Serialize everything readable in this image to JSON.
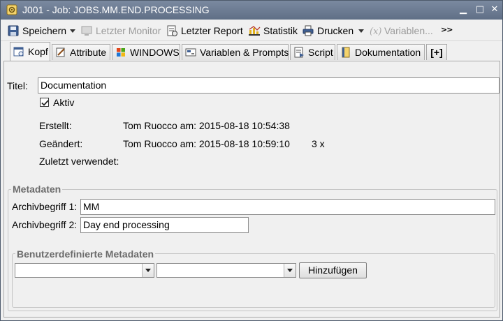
{
  "window": {
    "title": "J001 - Job: JOBS.MM.END.PROCESSING",
    "minimize_glyph": "▁",
    "maximize_glyph": "□",
    "close_glyph": "✕"
  },
  "toolbar": {
    "save_label": "Speichern",
    "last_monitor_label": "Letzter Monitor",
    "last_report_label": "Letzter Report",
    "statistics_label": "Statistik",
    "print_label": "Drucken",
    "variables_label": "Variablen...",
    "more_glyph": ">>"
  },
  "tabs": [
    {
      "label": "Kopf",
      "icon": "header-icon",
      "active": true
    },
    {
      "label": "Attribute",
      "icon": "attributes-icon"
    },
    {
      "label": "WINDOWS",
      "icon": "windows-icon"
    },
    {
      "label": "Variablen & Prompts",
      "icon": "variables-icon"
    },
    {
      "label": "Script",
      "icon": "script-icon"
    },
    {
      "label": "Dokumentation",
      "icon": "documentation-icon"
    },
    {
      "label": "[+]",
      "icon": "add-tab-icon"
    }
  ],
  "header": {
    "title_label": "Titel:",
    "title_value": "Documentation",
    "active_label": "Aktiv",
    "active_checked": true,
    "created_label": "Erstellt:",
    "created_value": "Tom Ruocco am: 2015-08-18 10:54:38",
    "modified_label": "Geändert:",
    "modified_value": "Tom Ruocco am: 2015-08-18 10:59:10",
    "modified_count": "3 x",
    "last_used_label": "Zuletzt verwendet:",
    "last_used_value": ""
  },
  "metadata": {
    "legend": "Metadaten",
    "archive1_label": "Archivbegriff 1:",
    "archive1_value": "MM",
    "archive2_label": "Archivbegriff 2:",
    "archive2_value": "Day end processing"
  },
  "custom_metadata": {
    "legend": "Benutzerdefinierte Metadaten",
    "select1_value": "",
    "select2_value": "",
    "add_label": "Hinzufügen"
  },
  "colors": {
    "titlebar": "#6a7a90",
    "border": "#a9a9a9",
    "background": "#f0f0f0"
  }
}
